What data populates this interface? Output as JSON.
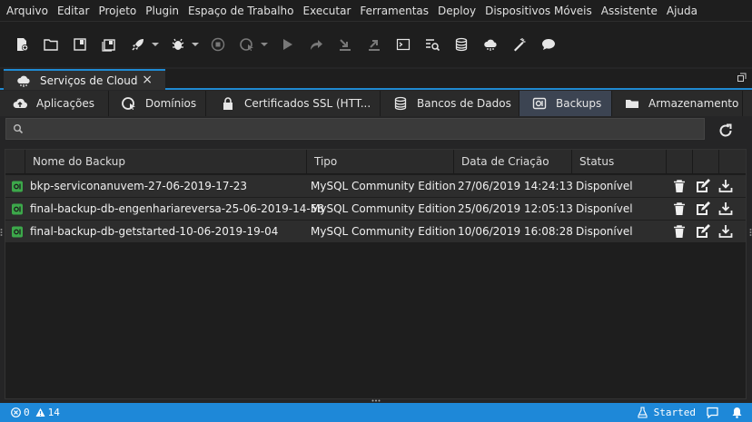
{
  "menu": [
    "Arquivo",
    "Editar",
    "Projeto",
    "Plugin",
    "Espaço de Trabalho",
    "Executar",
    "Ferramentas",
    "Deploy",
    "Dispositivos Móveis",
    "Assistente",
    "Ajuda"
  ],
  "toolbar_icons": [
    "new-file-icon",
    "open-folder-icon",
    "save-icon",
    "save-all-icon",
    "rocket-icon",
    "bug-icon",
    "stop-icon",
    "globe-run-icon",
    "play-icon",
    "redo-icon",
    "import-icon",
    "export-icon",
    "terminal-icon",
    "list-search-icon",
    "database-icon",
    "cloud-icon",
    "wand-icon",
    "chat-icon"
  ],
  "main_tab": {
    "label": "Serviços de Cloud",
    "close": "×"
  },
  "subtabs": [
    "Aplicações",
    "Domínios",
    "Certificados SSL (HTT...",
    "Bancos de Dados",
    "Backups",
    "Armazenamento"
  ],
  "search": {
    "placeholder": "",
    "value": ""
  },
  "table": {
    "columns": [
      "Nome do Backup",
      "Tipo",
      "Data de Criação",
      "Status"
    ],
    "rows": [
      {
        "name": "bkp-serviconanuvem-27-06-2019-17-23",
        "type": "MySQL Community Edition",
        "date": "27/06/2019 14:24:13",
        "status": "Disponível"
      },
      {
        "name": "final-backup-db-engenhariareversa-25-06-2019-14-58",
        "type": "MySQL Community Edition",
        "date": "25/06/2019 12:05:13",
        "status": "Disponível"
      },
      {
        "name": "final-backup-db-getstarted-10-06-2019-19-04",
        "type": "MySQL Community Edition",
        "date": "10/06/2019 16:08:28",
        "status": "Disponível"
      }
    ]
  },
  "status": {
    "errors": "0",
    "warnings": "14",
    "run_state": "Started"
  },
  "colors": {
    "accent": "#1f8ad2",
    "status_bar": "#1e88d8",
    "backup_icon": "#3ca84a",
    "active_subtab": "#3c4452"
  }
}
